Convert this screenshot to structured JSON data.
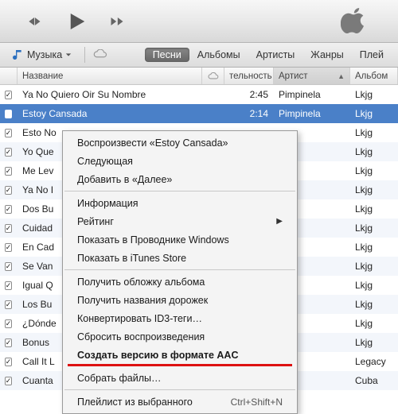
{
  "toolbar": {
    "apple_icon": "apple"
  },
  "viewbar": {
    "library_label": "Музыка",
    "tabs": [
      "Песни",
      "Альбомы",
      "Артисты",
      "Жанры",
      "Плей"
    ]
  },
  "columns": {
    "name": "Название",
    "duration": "тельность",
    "artist": "Артист",
    "album": "Альбом"
  },
  "tracks": [
    {
      "name": "Ya No Quiero Oir Su Nombre",
      "dur": "2:45",
      "artist": "Pimpinela",
      "album": "Lkjg"
    },
    {
      "name": "Estoy Cansada",
      "dur": "2:14",
      "artist": "Pimpinela",
      "album": "Lkjg",
      "selected": true
    },
    {
      "name": "Esto No",
      "dur": "",
      "artist": "",
      "album": "Lkjg"
    },
    {
      "name": "Yo Que",
      "dur": "",
      "artist": "",
      "album": "Lkjg"
    },
    {
      "name": "Me Lev",
      "dur": "",
      "artist": "",
      "album": "Lkjg"
    },
    {
      "name": "Ya No I",
      "dur": "",
      "artist": "",
      "album": "Lkjg"
    },
    {
      "name": "Dos Bu",
      "dur": "",
      "artist": "",
      "album": "Lkjg"
    },
    {
      "name": "Cuidad",
      "dur": "",
      "artist": "",
      "album": "Lkjg"
    },
    {
      "name": "En Cad",
      "dur": "",
      "artist": "",
      "album": "Lkjg"
    },
    {
      "name": "Se Van",
      "dur": "",
      "artist": "",
      "album": "Lkjg"
    },
    {
      "name": "Igual Q",
      "dur": "",
      "artist": "",
      "album": "Lkjg"
    },
    {
      "name": "Los Bu",
      "dur": "",
      "artist": "",
      "album": "Lkjg"
    },
    {
      "name": "¿Dónde",
      "dur": "",
      "artist": "",
      "album": "Lkjg"
    },
    {
      "name": "Bonus",
      "dur": "",
      "artist": "",
      "album": "Lkjg"
    },
    {
      "name": "Call It L",
      "dur": "",
      "artist": "",
      "album": "Legacy"
    },
    {
      "name": "Cuanta",
      "dur": "",
      "artist": "",
      "album": "Cuba"
    }
  ],
  "extra_albums": [
    "Legacy",
    "Legacy"
  ],
  "context_menu": {
    "play": "Воспроизвести «Estoy Cansada»",
    "next": "Следующая",
    "add_next": "Добавить в «Далее»",
    "info": "Информация",
    "rating": "Рейтинг",
    "show_explorer": "Показать в Проводнике Windows",
    "show_store": "Показать в iTunes Store",
    "get_art": "Получить обложку альбома",
    "get_names": "Получить названия дорожек",
    "convert_id3": "Конвертировать ID3-теги…",
    "reset_play": "Сбросить воспроизведения",
    "create_aac": "Создать версию в формате AAC",
    "gather_files": "Собрать файлы…",
    "playlist_from_sel": "Плейлист из выбранного",
    "playlist_shortcut": "Ctrl+Shift+N"
  }
}
